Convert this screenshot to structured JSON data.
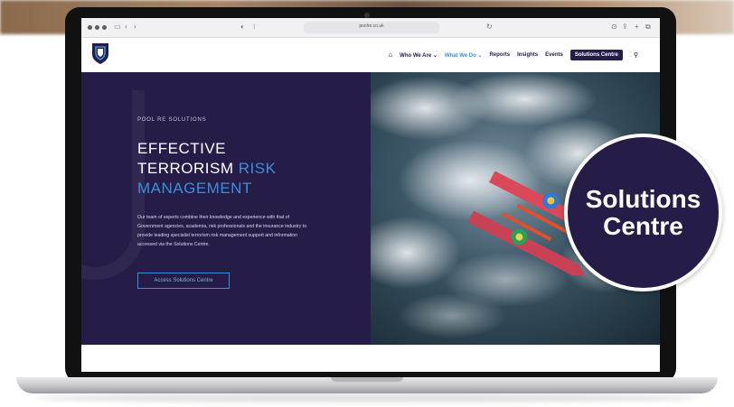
{
  "browser": {
    "url": "poolre.co.uk"
  },
  "site": {
    "nav": {
      "items": [
        {
          "label": "Who We Are ⌄"
        },
        {
          "label": "What We Do ⌄"
        },
        {
          "label": "Reports"
        },
        {
          "label": "Insights"
        },
        {
          "label": "Events"
        }
      ],
      "solutions_label": "Solutions Centre"
    },
    "hero": {
      "eyebrow": "POOL RE SOLUTIONS",
      "headline_line1": "EFFECTIVE",
      "headline_line2_plain": "TERRORISM ",
      "headline_line2_accent": "RISK",
      "headline_line3_accent": "MANAGEMENT",
      "body": "Our team of experts combine their knowledge and experience with that of Government agencies, academia, risk professionals and the insurance industry to provide leading specialist terrorism risk management support and information accessed via the Solutions Centre.",
      "cta_label": "Access Solutions Centre"
    }
  },
  "badge": {
    "line1": "Solutions",
    "line2": "Centre"
  },
  "colors": {
    "navy": "#251c47",
    "accent_blue": "#3f8ed9",
    "white": "#ffffff"
  },
  "icons": [
    "home-icon",
    "search-icon",
    "shield-logo-icon",
    "back-icon",
    "forward-icon",
    "share-icon",
    "new-tab-icon",
    "tabs-icon",
    "sidebar-icon"
  ]
}
